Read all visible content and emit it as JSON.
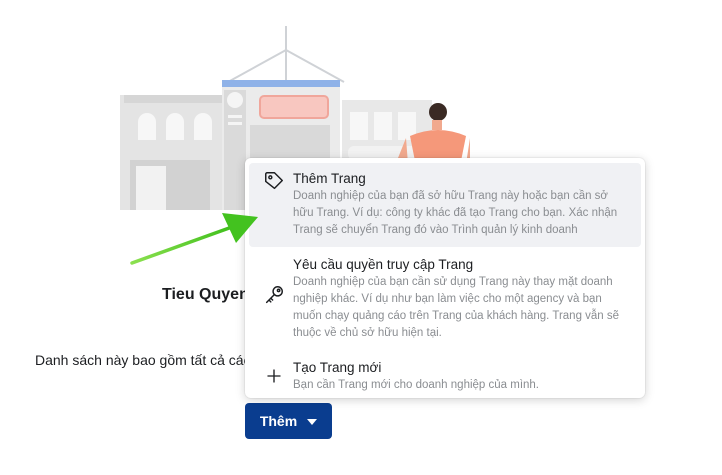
{
  "page": {
    "title": "Tieu Quyen",
    "description": "Danh sách này bao gồm tất cả các"
  },
  "add_button": {
    "label": "Thêm"
  },
  "dropdown": {
    "items": [
      {
        "title": "Thêm Trang",
        "description": "Doanh nghiệp của bạn đã sở hữu Trang này hoặc bạn cần sở hữu Trang. Ví dụ: công ty khác đã tạo Trang cho bạn. Xác nhận Trang sẽ chuyển Trang đó vào Trình quản lý kinh doanh",
        "icon": "tag-icon"
      },
      {
        "title": "Yêu cầu quyền truy cập Trang",
        "description": "Doanh nghiệp của bạn cần sử dụng Trang này thay mặt doanh nghiệp khác. Ví dụ như bạn làm việc cho một agency và bạn muốn chạy quảng cáo trên Trang của khách hàng. Trang vẫn sẽ thuộc về chủ sở hữu hiện tại.",
        "icon": "key-icon"
      },
      {
        "title": "Tạo Trang mới",
        "description": "Bạn cần Trang mới cho doanh nghiệp của mình.",
        "icon": "plus-icon"
      }
    ]
  },
  "colors": {
    "button_bg": "#0a3d8f",
    "arrow": "#5ccf2c",
    "hover_bg": "#f0f1f4"
  }
}
